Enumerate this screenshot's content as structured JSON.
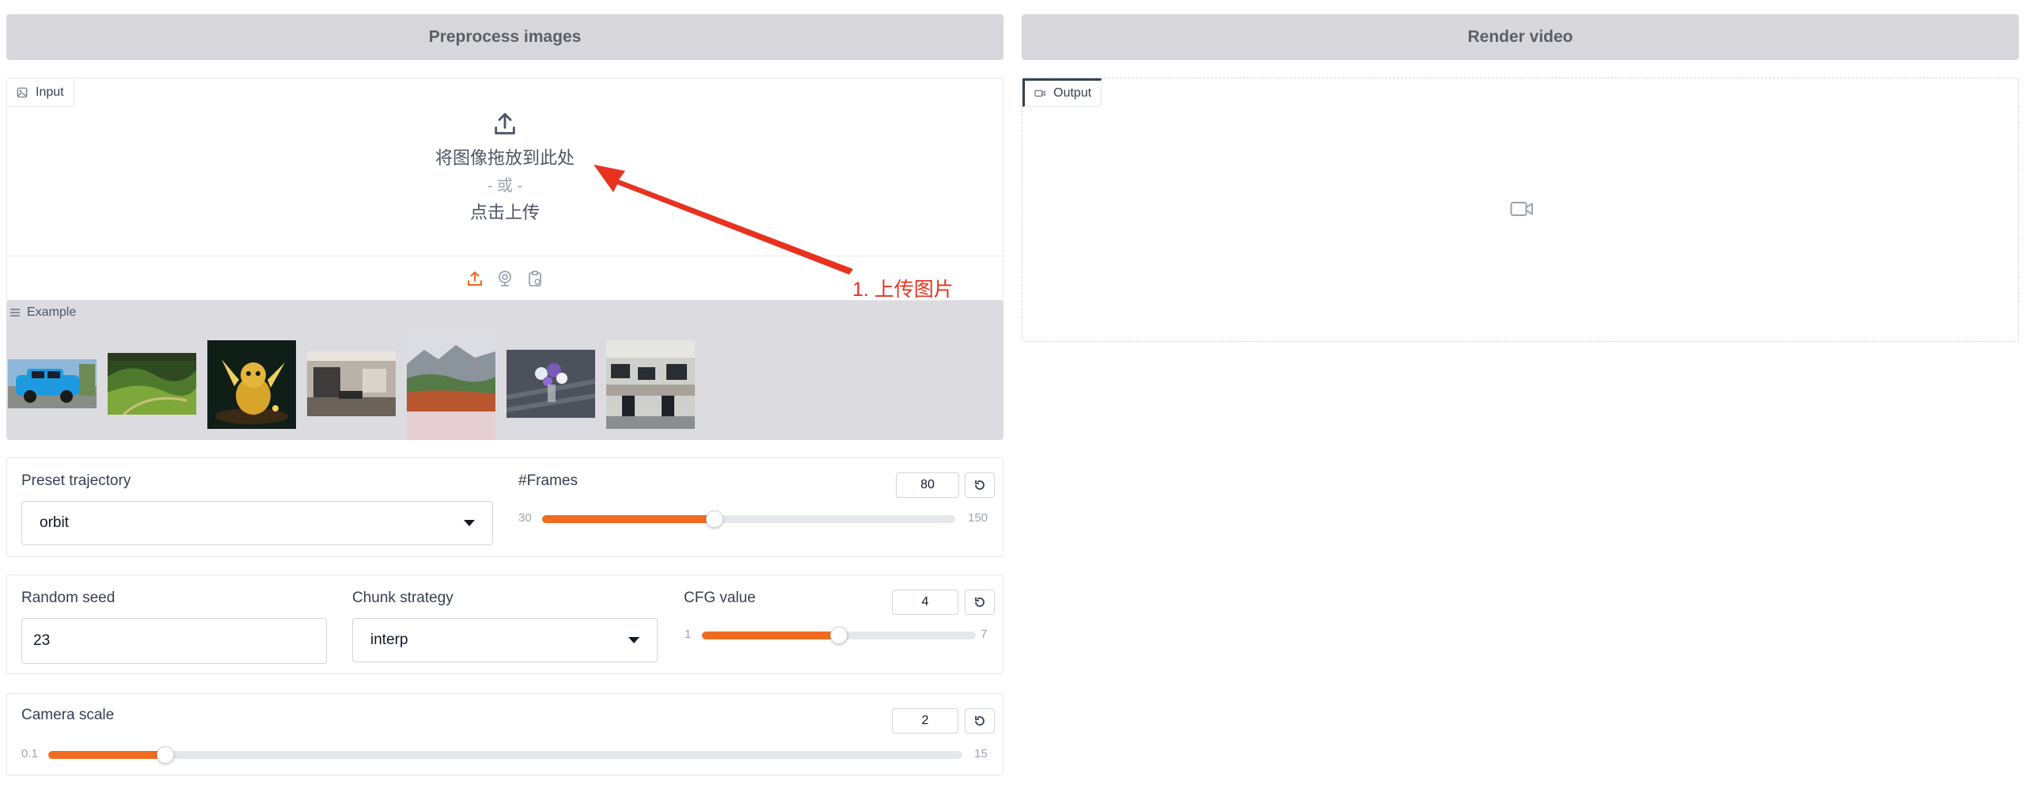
{
  "tabs": {
    "preprocess_label": "Preprocess images",
    "render_label": "Render video"
  },
  "input_panel": {
    "label": "Input",
    "drop_text": "将图像拖放到此处",
    "or_text": "- 或 -",
    "click_text": "点击上传",
    "sources": [
      "upload-icon",
      "webcam-icon",
      "clipboard-icon"
    ]
  },
  "output_panel": {
    "label": "Output"
  },
  "examples": {
    "label": "Example",
    "items": [
      "blue-car",
      "aerial-green-valley",
      "golden-dragon",
      "office-room",
      "mountain-lake",
      "flower-vase",
      "office-desks"
    ]
  },
  "annotation": {
    "text": "1. 上传图片",
    "color": "#e8321f"
  },
  "preset_trajectory": {
    "label": "Preset trajectory",
    "value": "orbit"
  },
  "frames": {
    "label": "#Frames",
    "value": "80",
    "min": "30",
    "max": "150",
    "current": 80
  },
  "random_seed": {
    "label": "Random seed",
    "value": "23"
  },
  "chunk_strategy": {
    "label": "Chunk strategy",
    "value": "interp"
  },
  "cfg": {
    "label": "CFG value",
    "value": "4",
    "min": "1",
    "max": "7",
    "current": 4
  },
  "camera_scale": {
    "label": "Camera scale",
    "value": "2",
    "min": "0.1",
    "max": "15",
    "current": 2
  },
  "colors": {
    "accent": "#f06b1f",
    "header_bg": "#d8d8dc",
    "examples_bg": "#dcdce0"
  }
}
